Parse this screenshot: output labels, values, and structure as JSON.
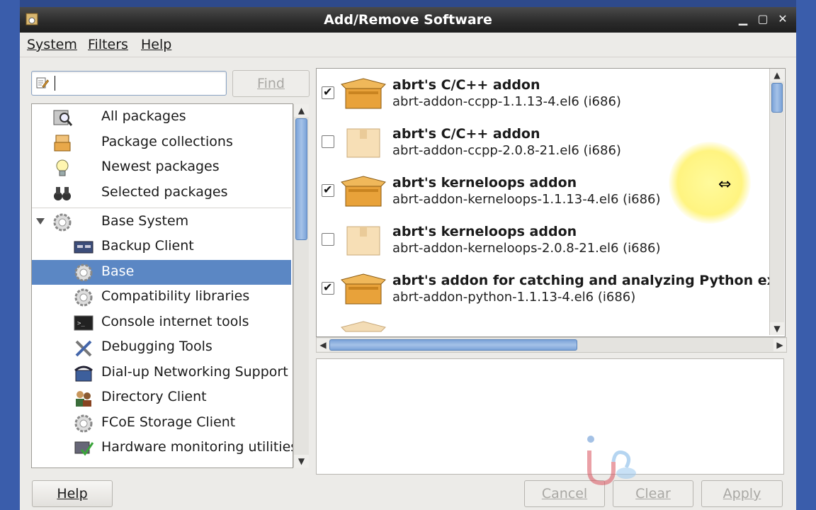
{
  "window": {
    "title": "Add/Remove Software"
  },
  "menubar": {
    "items": [
      "System",
      "Filters",
      "Help"
    ]
  },
  "search": {
    "value": "",
    "find_label": "Find"
  },
  "tree": {
    "items": [
      {
        "label": "All packages",
        "icon": "magnifier-box-icon"
      },
      {
        "label": "Package collections",
        "icon": "package-stack-icon"
      },
      {
        "label": "Newest packages",
        "icon": "lightbulb-icon"
      },
      {
        "label": "Selected packages",
        "icon": "binoculars-icon"
      },
      {
        "label": "Base System",
        "icon": "gear-icon",
        "expanded": true
      },
      {
        "label": "Backup Client",
        "icon": "tape-drive-icon"
      },
      {
        "label": "Base",
        "icon": "gear-icon",
        "selected": true
      },
      {
        "label": "Compatibility libraries",
        "icon": "gear-icon"
      },
      {
        "label": "Console internet tools",
        "icon": "terminal-icon"
      },
      {
        "label": "Debugging Tools",
        "icon": "tools-icon"
      },
      {
        "label": "Dial-up Networking Support",
        "icon": "phone-icon"
      },
      {
        "label": "Directory Client",
        "icon": "users-icon"
      },
      {
        "label": "FCoE Storage Client",
        "icon": "gear-icon"
      },
      {
        "label": "Hardware monitoring utilities",
        "icon": "monitor-check-icon"
      }
    ]
  },
  "packages": [
    {
      "name": "abrt's C/C++ addon",
      "version": "abrt-addon-ccpp-1.1.13-4.el6 (i686)",
      "checked": true,
      "installed": true
    },
    {
      "name": "abrt's C/C++ addon",
      "version": "abrt-addon-ccpp-2.0.8-21.el6 (i686)",
      "checked": false,
      "installed": false
    },
    {
      "name": "abrt's kerneloops addon",
      "version": "abrt-addon-kerneloops-1.1.13-4.el6 (i686)",
      "checked": true,
      "installed": true
    },
    {
      "name": "abrt's kerneloops addon",
      "version": "abrt-addon-kerneloops-2.0.8-21.el6 (i686)",
      "checked": false,
      "installed": false
    },
    {
      "name": "abrt's addon for catching and analyzing Python ex",
      "version": "abrt-addon-python-1.1.13-4.el6 (i686)",
      "checked": true,
      "installed": true
    }
  ],
  "buttons": {
    "help": "Help",
    "cancel": "Cancel",
    "clear": "Clear",
    "apply": "Apply"
  },
  "colors": {
    "selection": "#5b87c4",
    "titlebar": "#2a2a2a",
    "window_bg": "#ecebe8"
  }
}
